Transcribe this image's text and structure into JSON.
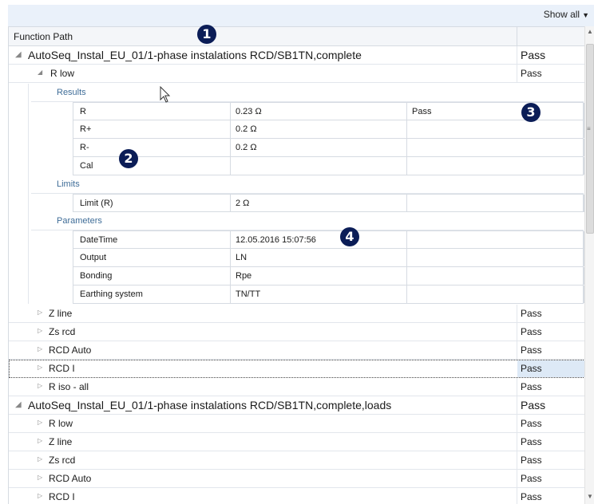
{
  "toolbar": {
    "show_all_label": "Show all",
    "caret": "▼"
  },
  "header": {
    "column_function_path": "Function Path"
  },
  "badges": [
    "1",
    "2",
    "3",
    "4"
  ],
  "sequence1": {
    "label": "AutoSeq_Instal_EU_01/1-phase instalations RCD/SB1TN,complete",
    "result": "Pass",
    "expanded_child": {
      "label": "R low",
      "result": "Pass"
    },
    "sections": {
      "results_label": "Results",
      "limits_label": "Limits",
      "parameters_label": "Parameters"
    },
    "results": [
      {
        "name": "R",
        "value": "0.23 Ω",
        "status": "Pass"
      },
      {
        "name": "R+",
        "value": "0.2 Ω",
        "status": ""
      },
      {
        "name": "R-",
        "value": "0.2 Ω",
        "status": ""
      },
      {
        "name": "Cal",
        "value": "",
        "status": ""
      }
    ],
    "limits": [
      {
        "name": "Limit  (R)",
        "value": "2 Ω"
      }
    ],
    "parameters": [
      {
        "name": "DateTime",
        "value": "12.05.2016 15:07:56"
      },
      {
        "name": "Output",
        "value": "LN"
      },
      {
        "name": "Bonding",
        "value": "Rpe"
      },
      {
        "name": "Earthing system",
        "value": "TN/TT"
      }
    ],
    "children": [
      {
        "label": "Z line",
        "result": "Pass"
      },
      {
        "label": "Zs rcd",
        "result": "Pass"
      },
      {
        "label": "RCD Auto",
        "result": "Pass"
      },
      {
        "label": "RCD I",
        "result": "Pass"
      },
      {
        "label": "R iso - all",
        "result": "Pass"
      }
    ]
  },
  "sequence2": {
    "label": "AutoSeq_Instal_EU_01/1-phase instalations RCD/SB1TN,complete,loads",
    "result": "Pass",
    "children": [
      {
        "label": "R low",
        "result": "Pass"
      },
      {
        "label": "Z line",
        "result": "Pass"
      },
      {
        "label": "Zs rcd",
        "result": "Pass"
      },
      {
        "label": "RCD Auto",
        "result": "Pass"
      },
      {
        "label": "RCD I",
        "result": "Pass"
      }
    ]
  },
  "icons": {
    "expanded": "◢",
    "collapsed": "▷"
  },
  "colors": {
    "badge": "#0b1d57",
    "section_label": "#3f6d98",
    "selected_result": "#dde9f6"
  }
}
